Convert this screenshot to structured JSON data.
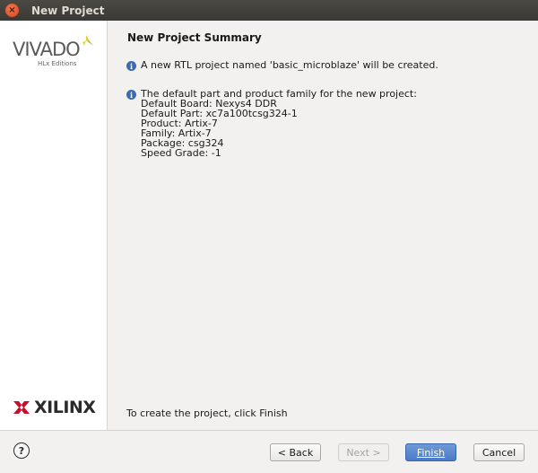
{
  "window": {
    "title": "New Project",
    "close_glyph": "×"
  },
  "sidebar": {
    "vivado_brand": "VIVADO",
    "vivado_subtitle": "HLx Editions",
    "xilinx_brand": "XILINX"
  },
  "main": {
    "heading": "New Project Summary",
    "info_icon_glyph": "i",
    "project_message": "A new RTL project named 'basic_microblaze' will be created.",
    "part_info": [
      "The default part and product family for the new project:",
      "Default Board: Nexys4 DDR",
      "Default Part: xc7a100tcsg324-1",
      "Product: Artix-7",
      "Family: Artix-7",
      "Package: csg324",
      "Speed Grade: -1"
    ],
    "finish_hint": "To create the project, click Finish"
  },
  "buttons": {
    "help": "?",
    "back": "< Back",
    "next": "Next >",
    "finish": "Finish",
    "cancel": "Cancel"
  },
  "colors": {
    "accent": "#4a7bc6",
    "info_icon": "#3a6cb5",
    "titlebar": "#3c3b37",
    "close_button": "#e3562d",
    "xilinx_red": "#c8102e",
    "vivado_mark": "#c9c12a"
  },
  "icons": {
    "close": "close-icon",
    "info": "info-icon",
    "help": "help-icon"
  }
}
